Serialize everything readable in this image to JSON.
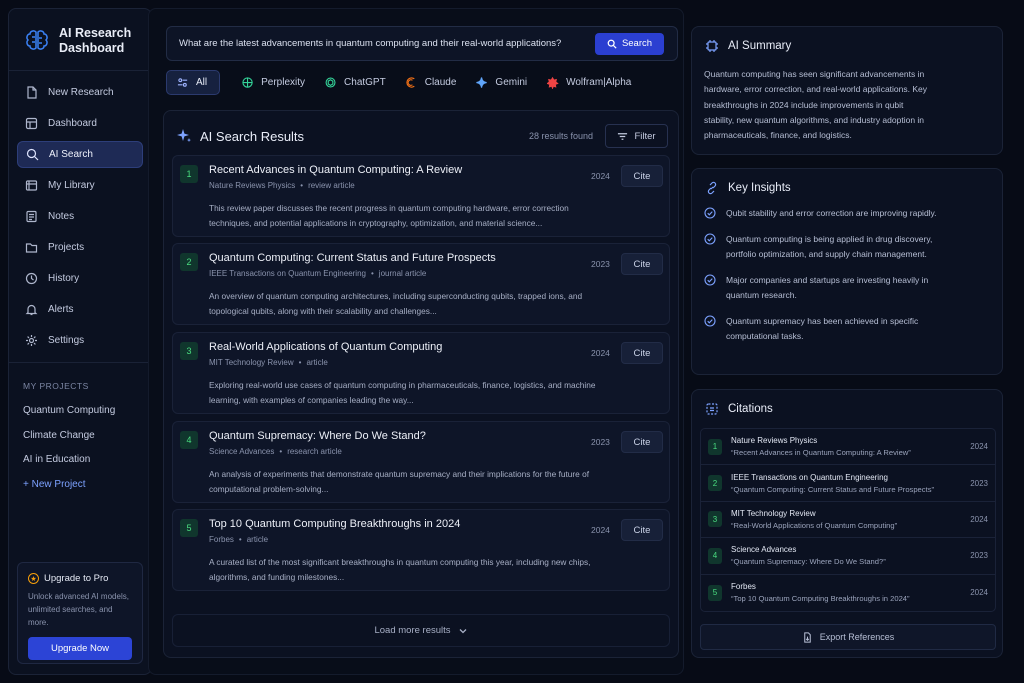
{
  "app": {
    "title": "AI Research Dashboard"
  },
  "sidebar": {
    "nav": [
      {
        "label": "New Research",
        "icon": "new-document-icon",
        "active": false
      },
      {
        "label": "Dashboard",
        "icon": "dashboard-icon",
        "active": false
      },
      {
        "label": "AI Search",
        "icon": "search-icon",
        "active": true
      },
      {
        "label": "My Library",
        "icon": "library-icon",
        "active": false
      },
      {
        "label": "Notes",
        "icon": "notes-icon",
        "active": false
      },
      {
        "label": "Projects",
        "icon": "folder-icon",
        "active": false
      },
      {
        "label": "History",
        "icon": "history-icon",
        "active": false
      },
      {
        "label": "Alerts",
        "icon": "bell-icon",
        "active": false
      },
      {
        "label": "Settings",
        "icon": "gear-icon",
        "active": false
      }
    ],
    "projects_label": "MY PROJECTS",
    "projects": [
      "Quantum Computing",
      "Climate Change",
      "AI in Education"
    ],
    "new_project": "+ New Project",
    "upgrade": {
      "title": "Upgrade to Pro",
      "desc": "Unlock advanced AI models, unlimited searches, and more.",
      "button": "Upgrade Now"
    }
  },
  "search": {
    "query": "What are the latest advancements in quantum computing and their real-world applications?",
    "button": "Search"
  },
  "tabs": [
    {
      "label": "All",
      "icon": "all-icon",
      "active": true
    },
    {
      "label": "Perplexity",
      "icon": "perplexity-icon",
      "active": false
    },
    {
      "label": "ChatGPT",
      "icon": "chatgpt-icon",
      "active": false
    },
    {
      "label": "Claude",
      "icon": "claude-icon",
      "active": false
    },
    {
      "label": "Gemini",
      "icon": "gemini-icon",
      "active": false
    },
    {
      "label": "Wolfram|Alpha",
      "icon": "wolfram-icon",
      "active": false
    }
  ],
  "results": {
    "title": "AI Search Results",
    "count": "28 results found",
    "filter": "Filter",
    "cite_label": "Cite",
    "items": [
      {
        "num": "1",
        "title": "Recent Advances in Quantum Computing: A Review",
        "source": "Nature Reviews Physics",
        "type": "review article",
        "year": "2024",
        "snippet": "This review paper discusses the recent progress in quantum computing hardware, error correction techniques, and potential applications in cryptography, optimization, and material science..."
      },
      {
        "num": "2",
        "title": "Quantum Computing: Current Status and Future Prospects",
        "source": "IEEE Transactions on Quantum Engineering",
        "type": "journal article",
        "year": "2023",
        "snippet": "An overview of quantum computing architectures, including superconducting qubits, trapped ions, and topological qubits, along with their scalability and challenges..."
      },
      {
        "num": "3",
        "title": "Real-World Applications of Quantum Computing",
        "source": "MIT Technology Review",
        "type": "article",
        "year": "2024",
        "snippet": "Exploring real-world use cases of quantum computing in pharmaceuticals, finance, logistics, and machine learning, with examples of companies leading the way..."
      },
      {
        "num": "4",
        "title": "Quantum Supremacy: Where Do We Stand?",
        "source": "Science Advances",
        "type": "research article",
        "year": "2023",
        "snippet": "An analysis of experiments that demonstrate quantum supremacy and their implications for the future of computational problem-solving..."
      },
      {
        "num": "5",
        "title": "Top 10 Quantum Computing Breakthroughs in 2024",
        "source": "Forbes",
        "type": "article",
        "year": "2024",
        "snippet": "A curated list of the most significant breakthroughs in quantum computing this year, including new chips, algorithms, and funding milestones..."
      }
    ],
    "load_more": "Load more results"
  },
  "summary": {
    "title": "AI Summary",
    "text": "Quantum computing has seen significant advancements in hardware, error correction, and real-world applications. Key breakthroughs in 2024 include improvements in qubit stability, new quantum algorithms, and industry adoption in pharmaceuticals, finance, and logistics."
  },
  "insights": {
    "title": "Key Insights",
    "items": [
      "Qubit stability and error correction are improving rapidly.",
      "Quantum computing is being applied in drug discovery, portfolio optimization, and supply chain management.",
      "Major companies and startups are investing heavily in quantum research.",
      "Quantum supremacy has been achieved in specific computational tasks."
    ]
  },
  "citations": {
    "title": "Citations",
    "items": [
      {
        "num": "1",
        "source": "Nature Reviews Physics",
        "title": "“Recent Advances in Quantum Computing: A Review”",
        "year": "2024"
      },
      {
        "num": "2",
        "source": "IEEE Transactions on Quantum Engineering",
        "title": "“Quantum Computing: Current Status and Future Prospects”",
        "year": "2023"
      },
      {
        "num": "3",
        "source": "MIT Technology Review",
        "title": "“Real-World Applications of Quantum Computing”",
        "year": "2024"
      },
      {
        "num": "4",
        "source": "Science Advances",
        "title": "“Quantum Supremacy: Where Do We Stand?”",
        "year": "2023"
      },
      {
        "num": "5",
        "source": "Forbes",
        "title": "“Top 10 Quantum Computing Breakthroughs in 2024”",
        "year": "2024"
      }
    ],
    "export": "Export References"
  },
  "colors": {
    "accent": "#2b3fd1",
    "background": "#070b16",
    "badge_green": "#4ade80"
  }
}
